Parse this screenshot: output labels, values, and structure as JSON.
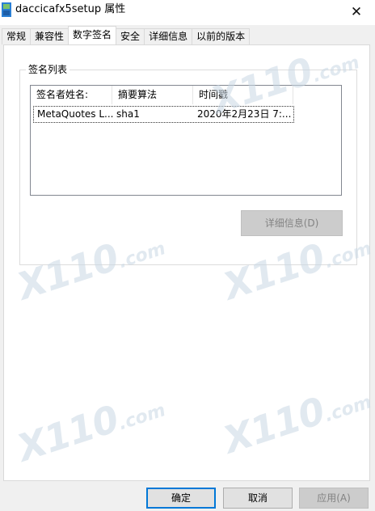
{
  "window": {
    "title": "daccicafx5setup 属性",
    "close_glyph": "✕"
  },
  "tabs": [
    {
      "label": "常规"
    },
    {
      "label": "兼容性"
    },
    {
      "label": "数字签名"
    },
    {
      "label": "安全"
    },
    {
      "label": "详细信息"
    },
    {
      "label": "以前的版本"
    }
  ],
  "active_tab": "数字签名",
  "signature_group": {
    "label": "签名列表",
    "columns": [
      "签名者姓名:",
      "摘要算法",
      "时间戳"
    ],
    "rows": [
      [
        "MetaQuotes L...",
        "sha1",
        "2020年2月23日 7:..."
      ]
    ],
    "details_button": "详细信息(D)"
  },
  "buttons": {
    "ok": "确定",
    "cancel": "取消",
    "apply": "应用(A)"
  },
  "watermark": {
    "text_big": "X110",
    "text_small": ".com"
  },
  "colors": {
    "accent": "#0078d7",
    "disabled_bg": "#cccccc",
    "disabled_text": "#838383"
  }
}
